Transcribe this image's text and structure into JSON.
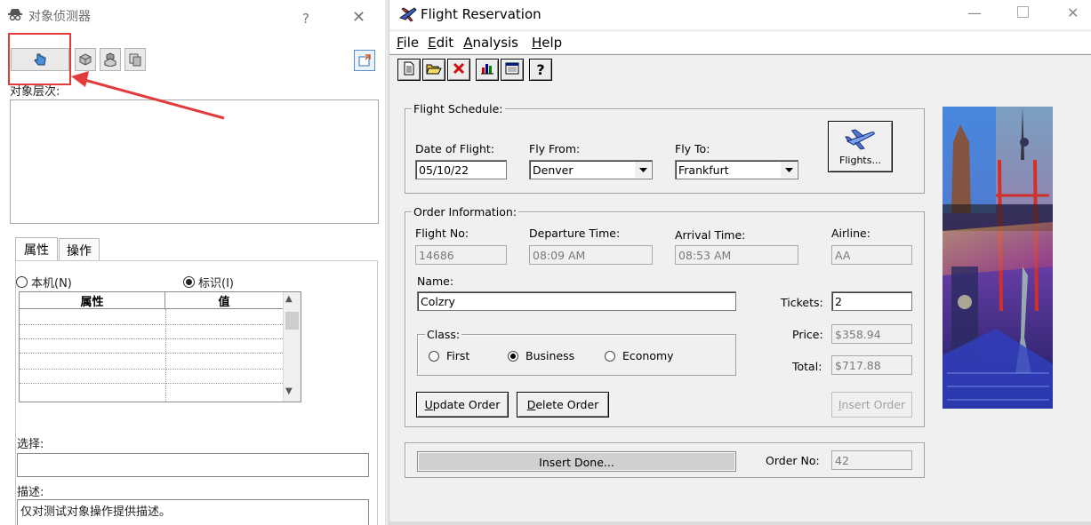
{
  "object_spy": {
    "title": "对象侦测器",
    "help_glyph": "?",
    "close_glyph": "✕",
    "hierarchy_label": "对象层次:",
    "tabs": [
      {
        "label": "属性"
      },
      {
        "label": "操作"
      }
    ],
    "radio_local": "本机(N)",
    "radio_identity": "标识(I)",
    "grid_headers": [
      "属性",
      "值"
    ],
    "select_label": "选择:",
    "desc_label": "描述:",
    "desc_text": "仅对测试对象操作提供描述。",
    "highlight_color": "#e23b3b"
  },
  "flight_reservation": {
    "title": "Flight Reservation",
    "menu": [
      {
        "label": "File",
        "u": "F",
        "rest": "ile"
      },
      {
        "label": "Edit",
        "u": "E",
        "rest": "dit"
      },
      {
        "label": "Analysis",
        "u": "A",
        "rest": "nalysis"
      },
      {
        "label": "Help",
        "u": "H",
        "rest": "elp"
      }
    ],
    "toolbar_icons": [
      "new-order-icon",
      "open-order-icon",
      "delete-order-icon",
      "graph-icon",
      "report-icon",
      "help-icon"
    ],
    "help_glyph": "?",
    "schedule": {
      "title": "Flight Schedule:",
      "date_label": "Date of Flight:",
      "date_value": "05/10/22",
      "from_label": "Fly From:",
      "from_value": "Denver",
      "to_label": "Fly To:",
      "to_value": "Frankfurt",
      "flights_button": "Flights..."
    },
    "order": {
      "title": "Order Information:",
      "flight_no_label": "Flight No:",
      "flight_no_value": "14686",
      "departure_label": "Departure Time:",
      "departure_value": "08:09 AM",
      "arrival_label": "Arrival Time:",
      "arrival_value": "08:53 AM",
      "airline_label": "Airline:",
      "airline_value": "AA",
      "name_label": "Name:",
      "name_value": "Colzry",
      "tickets_label": "Tickets:",
      "tickets_value": "2",
      "price_label": "Price:",
      "price_value": "$358.94",
      "total_label": "Total:",
      "total_value": "$717.88",
      "class_title": "Class:",
      "class_first": "First",
      "class_business": "Business",
      "class_economy": "Economy",
      "class_selected": "Business",
      "update_button": {
        "u": "U",
        "rest": "pdate Order"
      },
      "delete_button": {
        "u": "D",
        "rest": "elete Order"
      },
      "insert_button": {
        "u": "I",
        "rest": "nsert Order"
      }
    },
    "status": {
      "progress_text": "Insert Done...",
      "progress_fraction": 1.0,
      "order_no_label": "Order No:",
      "order_no_value": "42"
    }
  }
}
